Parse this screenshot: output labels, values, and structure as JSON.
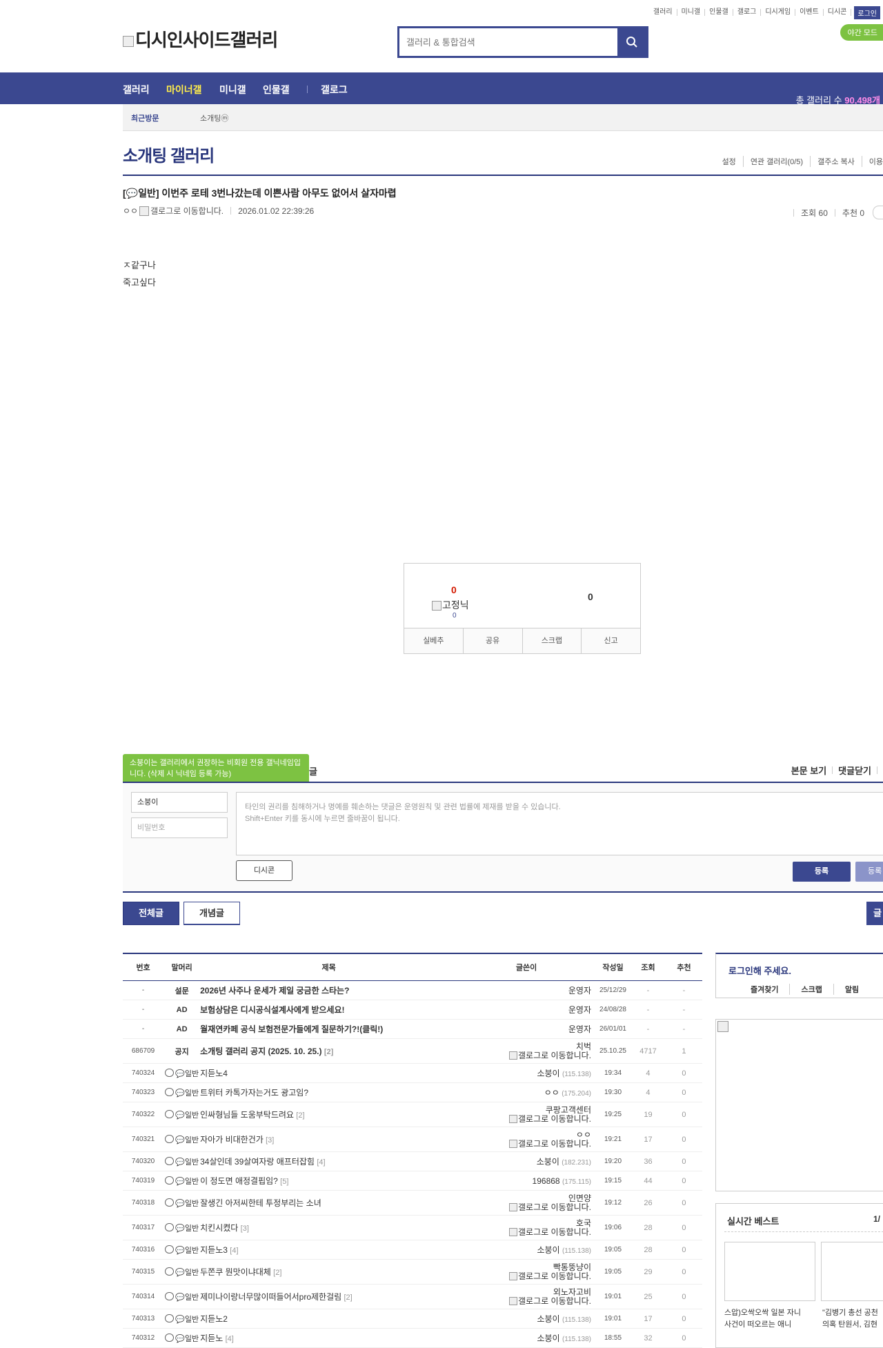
{
  "top_util": [
    "갤러리",
    "미니갤",
    "인물갤",
    "갤로그",
    "디시게임",
    "이벤트",
    "디시콘"
  ],
  "login_label": "로그인",
  "night_label": "야간 모드",
  "logo_text": "디시인사이드갤러리",
  "search": {
    "placeholder": "갤러리 & 통합검색"
  },
  "gnb": {
    "items": [
      "갤러리",
      "마이너갤",
      "미니갤",
      "인물갤",
      "갤로그"
    ],
    "active": "마이너갤"
  },
  "gallery_count": {
    "label": "총 갤러리 수",
    "value": "90,498개"
  },
  "visit": {
    "recent": "최근방문",
    "item": "소개팅ⓜ"
  },
  "gallery": {
    "title": "소개팅 갤러리",
    "options": [
      "설정",
      "연관 갤러리(0/5)",
      "갤주소 복사",
      "이용"
    ]
  },
  "post": {
    "title": "[💬일반] 이번주 로테 3번나갔는데 이쁜사람 아무도 없어서 살자마렵",
    "author": "ㅇㅇ",
    "gallog_alt": "갤로그로 이동합니다.",
    "date": "2026.01.02 22:39:26",
    "views": "조회 60",
    "recommend": "추천 0",
    "body": [
      "ㅈ같구나",
      "죽고싶다"
    ]
  },
  "recommend_box": {
    "up": "0",
    "fix_nick": "고정닉",
    "up_sub": "0",
    "down": "0",
    "buttons": [
      "실베추",
      "공유",
      "스크랩",
      "신고"
    ]
  },
  "comments": {
    "tooltip": "소붕이는 갤러리에서 권장하는 비회원 전용 갤닉네임입니다. (삭제 시 닉네임 등록 가능)",
    "tooltip_tail": "글",
    "view_body": "본문 보기",
    "close": "댓글닫기",
    "nick": "소붕이",
    "pw_placeholder": "비밀번호",
    "placeholder_1": "타인의 권리를 침해하거나 명예를 훼손하는 댓글은 운영원칙 및 관련 법률에 제재를 받을 수 있습니다.",
    "placeholder_2": "Shift+Enter 키를 동시에 누르면 줄바꿈이 됩니다.",
    "dccon": "디시콘",
    "register": "등록",
    "register2": "등록"
  },
  "tabs": {
    "all": "전체글",
    "best": "개념글",
    "right": "글"
  },
  "list": {
    "headers": [
      "번호",
      "말머리",
      "제목",
      "글쓴이",
      "작성일",
      "조회",
      "추천"
    ],
    "rows": [
      {
        "num": "-",
        "head": "설문",
        "title": "2026년 사주나 운세가 제일 궁금한 스타는?",
        "reply": "",
        "writer": "운영자",
        "ip": "",
        "gallog": false,
        "date": "25/12/29",
        "views": "-",
        "rec": "-",
        "notice": true
      },
      {
        "num": "-",
        "head": "AD",
        "title": "보험상담은 디시공식설계사에게 받으세요!",
        "reply": "",
        "writer": "운영자",
        "ip": "",
        "gallog": false,
        "date": "24/08/28",
        "views": "-",
        "rec": "-",
        "notice": true
      },
      {
        "num": "-",
        "head": "AD",
        "title": "월재연카페 공식 보험전문가들에게 질문하기?!(클릭!)",
        "reply": "",
        "writer": "운영자",
        "ip": "",
        "gallog": false,
        "date": "26/01/01",
        "views": "-",
        "rec": "-",
        "notice": true
      },
      {
        "num": "686709",
        "head": "공지",
        "title": "소개팅 갤러리 공지 (2025. 10. 25.)",
        "reply": "[2]",
        "writer": "치벅",
        "ip": "",
        "gallog": true,
        "date": "25.10.25",
        "views": "4717",
        "rec": "1",
        "notice": true
      },
      {
        "num": "740324",
        "head": "💬일반",
        "title": "지듣노4",
        "reply": "",
        "writer": "소붕이",
        "ip": "(115.138)",
        "gallog": false,
        "date": "19:34",
        "views": "4",
        "rec": "0",
        "notice": false
      },
      {
        "num": "740323",
        "head": "💬일반",
        "title": "트위터 카톡가자는거도 광고임?",
        "reply": "",
        "writer": "ㅇㅇ",
        "ip": "(175.204)",
        "gallog": false,
        "date": "19:30",
        "views": "4",
        "rec": "0",
        "notice": false
      },
      {
        "num": "740322",
        "head": "💬일반",
        "title": "인싸형님들 도움부탁드려요",
        "reply": "[2]",
        "writer": "쿠팡고객센터",
        "ip": "",
        "gallog": true,
        "date": "19:25",
        "views": "19",
        "rec": "0",
        "notice": false
      },
      {
        "num": "740321",
        "head": "💬일반",
        "title": "자아가 비대한건가",
        "reply": "[3]",
        "writer": "ㅇㅇ",
        "ip": "",
        "gallog": true,
        "date": "19:21",
        "views": "17",
        "rec": "0",
        "notice": false
      },
      {
        "num": "740320",
        "head": "💬일반",
        "title": "34살인데 39살여자랑 애프터잡힘",
        "reply": "[4]",
        "writer": "소붕이",
        "ip": "(182.231)",
        "gallog": false,
        "date": "19:20",
        "views": "36",
        "rec": "0",
        "notice": false
      },
      {
        "num": "740319",
        "head": "💬일반",
        "title": "이 정도면 애정결핍임?",
        "reply": "[5]",
        "writer": "196868",
        "ip": "(175.115)",
        "gallog": false,
        "date": "19:15",
        "views": "44",
        "rec": "0",
        "notice": false
      },
      {
        "num": "740318",
        "head": "💬일반",
        "title": "잘생긴 아저씨한테 투정부리는 소녀",
        "reply": "",
        "writer": "인면양",
        "ip": "",
        "gallog": true,
        "date": "19:12",
        "views": "26",
        "rec": "0",
        "notice": false
      },
      {
        "num": "740317",
        "head": "💬일반",
        "title": "치킨시켰다",
        "reply": "[3]",
        "writer": "호국",
        "ip": "",
        "gallog": true,
        "date": "19:06",
        "views": "28",
        "rec": "0",
        "notice": false
      },
      {
        "num": "740316",
        "head": "💬일반",
        "title": "지듣노3",
        "reply": "[4]",
        "writer": "소붕이",
        "ip": "(115.138)",
        "gallog": false,
        "date": "19:05",
        "views": "28",
        "rec": "0",
        "notice": false
      },
      {
        "num": "740315",
        "head": "💬일반",
        "title": "두쫀쿠 뭔맛이냐대체",
        "reply": "[2]",
        "writer": "빡통뚱냥이",
        "ip": "",
        "gallog": true,
        "date": "19:05",
        "views": "29",
        "rec": "0",
        "notice": false
      },
      {
        "num": "740314",
        "head": "💬일반",
        "title": "제미나이랑너무많이떠들어서pro제한걸림",
        "reply": "[2]",
        "writer": "외노자고비",
        "ip": "",
        "gallog": true,
        "date": "19:01",
        "views": "25",
        "rec": "0",
        "notice": false
      },
      {
        "num": "740313",
        "head": "💬일반",
        "title": "지듣노2",
        "reply": "",
        "writer": "소붕이",
        "ip": "(115.138)",
        "gallog": false,
        "date": "19:01",
        "views": "17",
        "rec": "0",
        "notice": false
      },
      {
        "num": "740312",
        "head": "💬일반",
        "title": "지듣노",
        "reply": "[4]",
        "writer": "소붕이",
        "ip": "(115.138)",
        "gallog": false,
        "date": "18:55",
        "views": "32",
        "rec": "0",
        "notice": false
      }
    ]
  },
  "side": {
    "login_title": "로그인해 주세요.",
    "login_links": [
      "즐겨찾기",
      "스크랩",
      "알림"
    ],
    "best_title": "실시간 베스트",
    "best_page": "1/",
    "best_items": [
      {
        "line1": "스압)오싹오싹 일본 자니",
        "line2": "사건이 떠오르는 애니"
      },
      {
        "line1": "\"김병기 총선 공천",
        "line2": "의혹 탄원서, 김현"
      }
    ]
  },
  "colors": {
    "brand": "#3b4890",
    "brand_dark": "#29367c",
    "active_menu": "#ffed4b",
    "green": "#7dc242",
    "count": "#ff8de9",
    "up": "#d31900"
  }
}
